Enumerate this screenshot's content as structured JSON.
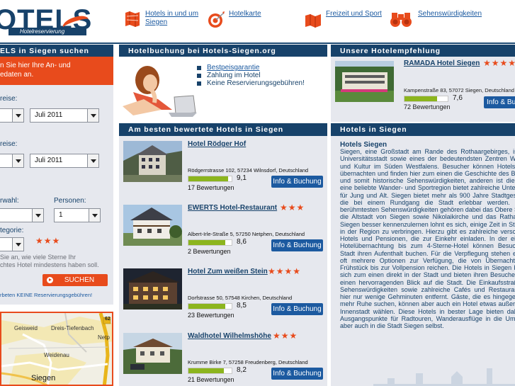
{
  "logo": {
    "wordmark": "OTELS",
    "tagline": "Hotelreservierung"
  },
  "nav": [
    {
      "icon": "city-map-icon",
      "label": "Hotels in und um Siegen",
      "line1": "Hotels in und um",
      "line2": "Siegen"
    },
    {
      "icon": "target-icon",
      "label": "Hotelkarte"
    },
    {
      "icon": "leisure-icon",
      "label": "Freizeit und Sport"
    },
    {
      "icon": "binoculars-icon",
      "label": "Sehenswürdigkeiten"
    }
  ],
  "search": {
    "header": "ELS in Siegen suchen",
    "intro_line1": "n Sie hier Ihre An- und",
    "intro_line2": "edaten an.",
    "arrival_label": "reise:",
    "arrival_month": "Juli 2011",
    "departure_label": "reise:",
    "departure_month": "Juli 2011",
    "rooms_label": "rwahl:",
    "persons_label": "Personen:",
    "persons_value": "1",
    "category_label": "tegorie:",
    "category_stars": "★★★",
    "category_desc_line1": "Sie  an,  wie  viele  Sterne  Ihr",
    "category_desc_line2": "chtes Hotel mindestens haben soll.",
    "search_button": "SUCHEN",
    "note": "rbeten KEINE Reservierungsgebühren!"
  },
  "map": {
    "labels": [
      "Geisweid",
      "Dreis-Tiefenbach",
      "Netp",
      "Weidenau",
      "Siegen"
    ],
    "road_numbers": [
      "62"
    ]
  },
  "booking": {
    "header": "Hotelbuchung bei Hotels-Siegen.org",
    "items": [
      {
        "label": "Bestpeisgarantie",
        "link": true
      },
      {
        "label": "Zahlung im Hotel",
        "link": false
      },
      {
        "label": "Keine Reservierungsgebühren!",
        "link": false
      }
    ]
  },
  "best": {
    "header": "Am besten bewertete Hotels in Siegen",
    "hotels": [
      {
        "name": "Hotel Rödger Hof",
        "stars": "",
        "address": "Rödgerrstrasse 102, 57234 Wilnsdorf, Deutschland",
        "rating": 9.1,
        "rating_text": "9,1",
        "reviews": "17 Bewertungen",
        "button": "Info & Buchung"
      },
      {
        "name": "EWERTS Hotel-Restaurant",
        "stars": "★★★",
        "address": "Albert-Irle-Straße 5, 57250 Netphen, Deutschland",
        "rating": 8.6,
        "rating_text": "8,6",
        "reviews": "2 Bewertungen",
        "button": "Info & Buchung"
      },
      {
        "name": "Hotel Zum weißen Stein",
        "stars": "★★★★",
        "address": "Dorfstrasse 50, 57548 Kirchen, Deutschland",
        "rating": 8.5,
        "rating_text": "8,5",
        "reviews": "23 Bewertungen",
        "button": "Info & Buchung"
      },
      {
        "name": "Waldhotel Wilhelmshöhe",
        "stars": "★★★",
        "address": "Krumme Birke 7, 57258 Freudenberg, Deutschland",
        "rating": 8.2,
        "rating_text": "8,2",
        "reviews": "21 Bewertungen",
        "button": "Info & Buchung"
      }
    ]
  },
  "recommend": {
    "header": "Unsere Hotelempfehlung",
    "name": "RAMADA Hotel Siegen",
    "stars": "★★★★",
    "address": "Kampenstraße 83, 57072 Siegen, Deutschland",
    "rating": 7.6,
    "rating_text": "7,6",
    "reviews": "72 Bewertungen",
    "button": "Info & Bu"
  },
  "siegen": {
    "header": "Hotels in Siegen",
    "title": "Hotels Siegen",
    "text": "Siegen, eine Großstadt am Rande des Rothaargebirges, ist junge Universitätsstadt sowie eines der bedeutendsten Zentren Wirtschaft und Kultur im Süden Westfalens. Besucher können Hotels Siegen übernachten und finden hier zum einen die Geschichte des Bergbaus und somit historische Sehenswürdigkeiten, anderen ist die Region eine beliebte Wander- und Sportregion bietet zahlreiche Unterhaltung für Jung und Alt. Siegen bietet mehr als 900 Jahre Stadtgeschichte, die bei einem Rundgang die Stadt erlebbar werden. Zu den berühmtesten Sehenswürdigkeiten gehören dabei das Obere Schloss, die Altstadt von Siegen sowie Nikolaikirche und das Rathaus. Um Siegen besser kennenzulernen lohnt es sich, einige Zeit in Stadt oder in der Region zu verbringen. Hierzu gibt es zahlreiche verschiedene Hotels und Pensionen, die zur Einkehr einladen. In der einfachen Hotelübernachtung bis zum 4-Sterne-Hotel können Besucher der Stadt ihren Aufenthalt buchen. Für die Verpflegung stehen ebenfalls oft mehrere Optionen zur Verfügung, die von Übernachtung mit Frühstück bis zur Vollpension reichen. Die Hotels in Siegen befinden sich zum einen direkt in der Stadt und bieten ihren Besuchern somit einen hervorragenden Blick auf die Stadt. Die Einkaufsstraßen, die Sehenswürdigkeiten sowie zahlreiche Cafés und Restaurants sind hier nur wenige Gehminuten entfernt. Gäste, die es hingegen etwas mehr Ruhe suchen, können aber auch ein Hotel etwas außerhalb der Innenstadt wählen. Diese Hotels in bester Lage bieten dabei gute Ausgangspunkte für Radtouren, Wanderausflüge in die Umgebung, aber auch in die Stadt Siegen selbst."
  },
  "colors": {
    "navy": "#17426a",
    "link": "#1c5aa0",
    "orange": "#e84b1c",
    "panel": "#e6e8ee",
    "green": "#8cb51e"
  }
}
